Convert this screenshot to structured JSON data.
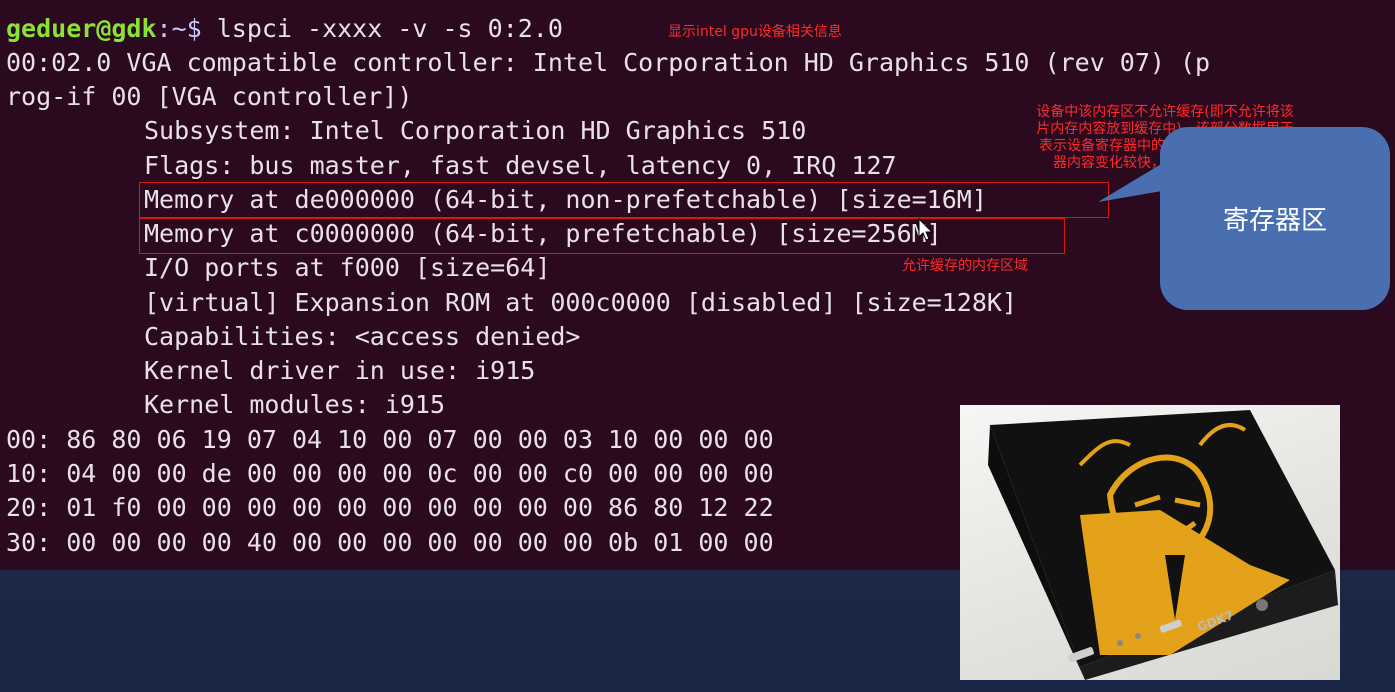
{
  "terminal": {
    "prompt_user": "geduer@gdk",
    "prompt_path": ":~$",
    "command": " lspci -xxxx -v -s 0:2.0",
    "lines": [
      "00:02.0 VGA compatible controller: Intel Corporation HD Graphics 510 (rev 07) (p",
      "rog-if 00 [VGA controller])"
    ],
    "details": [
      "Subsystem: Intel Corporation HD Graphics 510",
      "Flags: bus master, fast devsel, latency 0, IRQ 127",
      "Memory at de000000 (64-bit, non-prefetchable) [size=16M]",
      "Memory at c0000000 (64-bit, prefetchable) [size=256M]",
      "I/O ports at f000 [size=64]",
      "[virtual] Expansion ROM at 000c0000 [disabled] [size=128K]",
      "Capabilities: <access denied>",
      "Kernel driver in use: i915",
      "Kernel modules: i915"
    ],
    "hexdump": [
      "00: 86 80 06 19 07 04 10 00 07 00 00 03 10 00 00 00",
      "10: 04 00 00 de 00 00 00 00 0c 00 00 c0 00 00 00 00",
      "20: 01 f0 00 00 00 00 00 00 00 00 00 00 86 80 12 22",
      "30: 00 00 00 00 40 00 00 00 00 00 00 00 0b 01 00 00"
    ]
  },
  "annotations": {
    "command_note": "显示intel gpu设备相关信息",
    "noncache_note": [
      "设备中该内存区不允许缓存(即不允许将该",
      "片内存内容放到缓存中)，该部分数据用于",
      "表示设备寄存器中的数据，由于设备寄存",
      "器内容变化较快，故不允许进行缓存"
    ],
    "cache_note": "允许缓存的内存区域",
    "callout": "寄存器区"
  },
  "device_photo": {
    "brand_text": "GDK7"
  },
  "colors": {
    "terminal_bg": "#2b0a1f",
    "prompt_green": "#8ae234",
    "annotation_red": "#ff2a2a",
    "callout_blue": "#4a6fb0",
    "device_yellow": "#e3a21a"
  }
}
